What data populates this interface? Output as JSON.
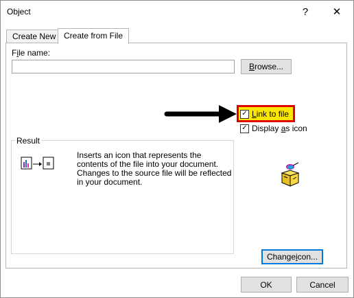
{
  "dialog": {
    "title": "Object",
    "help_label": "?",
    "close_label": "✕"
  },
  "tabs": [
    {
      "label": "Create New",
      "active": false
    },
    {
      "label": "Create from File",
      "active": true
    }
  ],
  "file": {
    "label_prefix": "F",
    "label_underlined": "i",
    "label_suffix": "le name:",
    "value": "",
    "browse_underlined": "B",
    "browse_rest": "rowse..."
  },
  "options": {
    "link_checked": true,
    "link_underlined": "L",
    "link_rest": "ink to file",
    "display_checked": true,
    "display_prefix": "Display ",
    "display_underlined": "a",
    "display_suffix": "s icon"
  },
  "result": {
    "legend": "Result",
    "lines": [
      "Inserts an icon that represents the",
      "contents of the file into your document.",
      "Changes to the source file will be reflected",
      "in your document."
    ]
  },
  "change_icon": {
    "prefix": "Change ",
    "underlined": "i",
    "suffix": "con..."
  },
  "footer": {
    "ok_label": "OK",
    "cancel_label": "Cancel"
  },
  "colors": {
    "highlight_fill": "#ffe800",
    "highlight_border": "#e00000",
    "focus_border": "#0078d7"
  }
}
